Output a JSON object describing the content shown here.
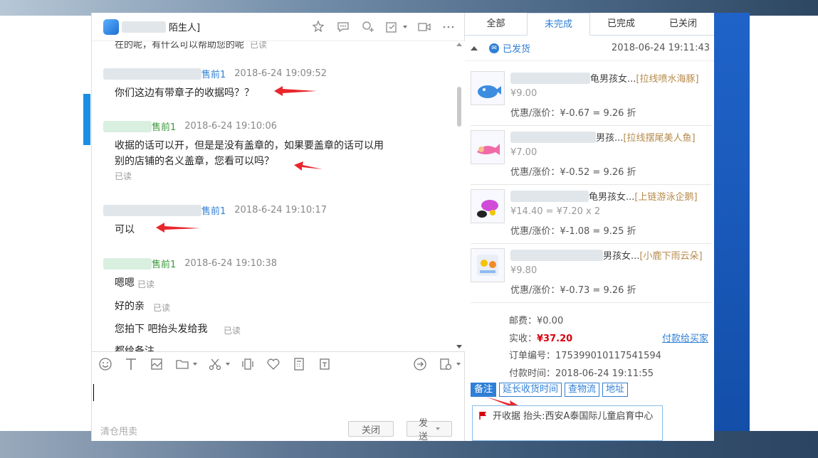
{
  "chat": {
    "title_suffix": "陌生人]",
    "top_cut_text": "在的呢，有什么可以帮助您的呢",
    "top_cut_read": "已读",
    "messages": [
      {
        "sender_suffix": "售前1",
        "time": "2018-6-24 19:09:52",
        "lines": [
          "你们这边有带章子的收据吗？？"
        ],
        "read": ""
      },
      {
        "sender_suffix": "售前1",
        "time": "2018-6-24 19:10:06",
        "lines": [
          "收据的话可以开，但是是没有盖章的，如果要盖章的话可以用",
          "别的店铺的名义盖章，您看可以吗？"
        ],
        "read": "已读"
      },
      {
        "sender_suffix": "售前1",
        "time": "2018-6-24 19:10:17",
        "lines": [
          "可以"
        ],
        "read": ""
      },
      {
        "sender_suffix": "售前1",
        "time": "2018-6-24 19:10:38",
        "lines": [
          "嗯嗯",
          "好的亲",
          "您拍下  吧抬头发给我",
          "都给备注"
        ],
        "read": "已读"
      }
    ],
    "clear_label": "清仓甩卖",
    "close_label": "关闭",
    "send_label": "发送"
  },
  "orders": {
    "tabs": [
      "全部",
      "未完成",
      "已完成",
      "已关闭"
    ],
    "active_tab": 1,
    "status": "已发货",
    "order_time": "2018-06-24 19:11:43",
    "items": [
      {
        "title_suffix": "龟男孩女...",
        "sku": "[拉线喷水海豚]",
        "price": "¥9.00",
        "discount": "优惠/涨价：¥-0.67 = 9.26 折"
      },
      {
        "title_suffix": "男孩...",
        "sku": "[拉线摆尾美人鱼]",
        "price": "¥7.00",
        "discount": "优惠/涨价：¥-0.52 = 9.26 折"
      },
      {
        "title_suffix": "龟男孩女...",
        "sku": "[上链游泳企鹅]",
        "price": "¥14.40 = ¥7.20 x 2",
        "discount": "优惠/涨价：¥-1.08 = 9.25 折"
      },
      {
        "title_suffix": "男孩女...",
        "sku": "[小鹿下雨云朵]",
        "price": "¥9.80",
        "discount": "优惠/涨价：¥-0.73 = 9.26 折"
      }
    ],
    "postage": "邮费：¥0.00",
    "actual_label": "实收：",
    "actual_value": "¥37.20",
    "pay_link": "付款给买家",
    "order_no": "订单编号：175399010117541594",
    "pay_time": "付款时间：2018-06-24 19:11:55",
    "actions": [
      "备注",
      "延长收货时间",
      "查物流",
      "地址"
    ],
    "note": "开收据 抬头:西安A泰国际儿童启育中心"
  },
  "colors": {
    "accent": "#2f7fd6",
    "price_red": "#d7000f",
    "arrow_red": "#e8262b"
  }
}
